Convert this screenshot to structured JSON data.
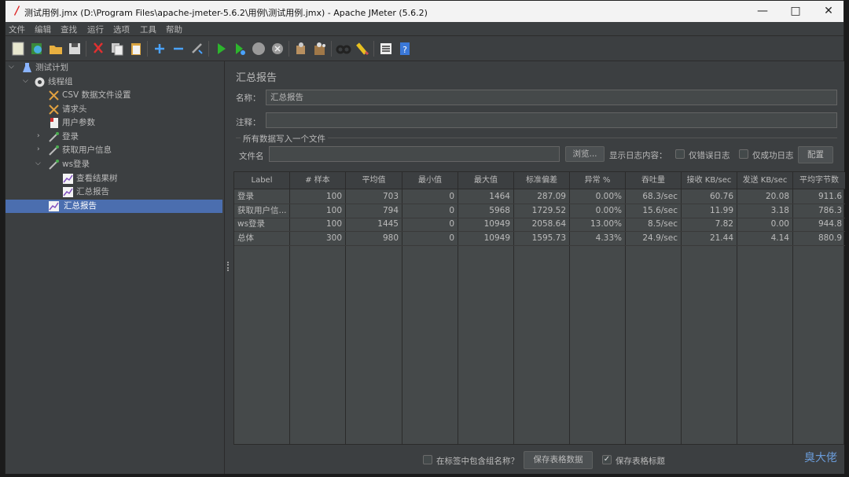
{
  "window": {
    "title": "测试用例.jmx (D:\\Program Files\\apache-jmeter-5.6.2\\用例\\测试用例.jmx) - Apache JMeter (5.6.2)"
  },
  "menu": [
    "文件",
    "编辑",
    "查找",
    "运行",
    "选项",
    "工具",
    "帮助"
  ],
  "toolbar_icons": [
    "new-icon",
    "templates-icon",
    "open-icon",
    "save-icon",
    "cut-icon",
    "copy-icon",
    "paste-icon",
    "expand-icon",
    "collapse-icon",
    "toggle-icon",
    "start-icon",
    "start-no-pause-icon",
    "stop-icon",
    "shutdown-icon",
    "clear-icon",
    "clear-all-icon",
    "search-icon",
    "reset-search-icon",
    "function-helper-icon",
    "help-icon"
  ],
  "tree": {
    "items": [
      {
        "label": "测试计划",
        "icon": "flask-icon"
      },
      {
        "label": "线程组",
        "icon": "gear-icon"
      },
      {
        "label": "CSV 数据文件设置",
        "icon": "tools-icon"
      },
      {
        "label": "请求头",
        "icon": "tools-icon"
      },
      {
        "label": "用户参数",
        "icon": "doc-icon"
      },
      {
        "label": "登录",
        "icon": "pipette-icon"
      },
      {
        "label": "获取用户信息",
        "icon": "pipette-icon"
      },
      {
        "label": "ws登录",
        "icon": "pipette-icon"
      },
      {
        "label": "查看结果树",
        "icon": "chart-icon"
      },
      {
        "label": "汇总报告",
        "icon": "chart-icon"
      },
      {
        "label": "汇总报告",
        "icon": "chart-icon"
      }
    ]
  },
  "panel": {
    "title": "汇总报告",
    "name_label": "名称：",
    "name_value": "汇总报告",
    "comment_label": "注释：",
    "comment_value": "",
    "file_section": "所有数据写入一个文件",
    "filename_label": "文件名",
    "filename_value": "",
    "browse": "浏览...",
    "log_content_label": "显示日志内容：",
    "errors_only": "仅错误日志",
    "success_only": "仅成功日志",
    "configure": "配置"
  },
  "table": {
    "headers": [
      "Label",
      "# 样本",
      "平均值",
      "最小值",
      "最大值",
      "标准偏差",
      "异常 %",
      "吞吐量",
      "接收 KB/sec",
      "发送 KB/sec",
      "平均字节数"
    ],
    "rows": [
      [
        "登录",
        "100",
        "703",
        "0",
        "1464",
        "287.09",
        "0.00%",
        "68.3/sec",
        "60.76",
        "20.08",
        "911.6"
      ],
      [
        "获取用户信...",
        "100",
        "794",
        "0",
        "5968",
        "1729.52",
        "0.00%",
        "15.6/sec",
        "11.99",
        "3.18",
        "786.3"
      ],
      [
        "ws登录",
        "100",
        "1445",
        "0",
        "10949",
        "2058.64",
        "13.00%",
        "8.5/sec",
        "7.82",
        "0.00",
        "944.8"
      ],
      [
        "总体",
        "300",
        "980",
        "0",
        "10949",
        "1595.73",
        "4.33%",
        "24.9/sec",
        "21.44",
        "4.14",
        "880.9"
      ]
    ]
  },
  "bottom": {
    "include_group": "在标签中包含组名称？",
    "save_table": "保存表格数据",
    "save_header": "保存表格标题",
    "save_header_checked": true
  },
  "watermark": "臭大佬"
}
